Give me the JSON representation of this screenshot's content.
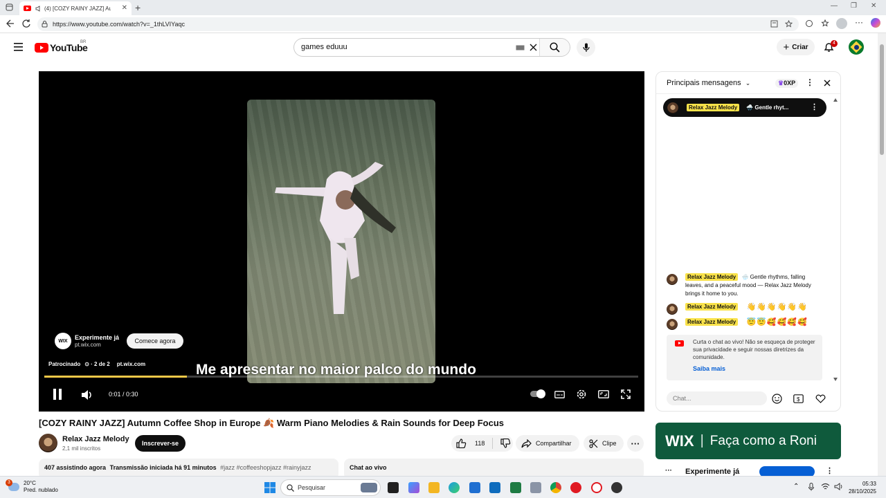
{
  "browser": {
    "tab_title": "(4) [COZY RAINY JAZZ] Autumn",
    "url": "https://www.youtube.com/watch?v=_1thLVIYaqc"
  },
  "header": {
    "logo_text": "YouTube",
    "country_code": "BR",
    "search_value": "games eduuu",
    "create_label": "Criar",
    "notif_count": "4"
  },
  "player": {
    "subtitle": "Me apresentar no maior palco do mundo",
    "ad_title": "Experimente já",
    "ad_domain": "pt.wix.com",
    "ad_cta": "Comece agora",
    "sponsored": "Patrocinado",
    "ad_count": "2 de 2",
    "ad_site": "pt.wix.com",
    "wix_badge": "WIX",
    "time": "0:01 / 0:30",
    "progress": 0.24
  },
  "video": {
    "title": "[COZY RAINY JAZZ] Autumn Coffee Shop in Europe 🍂 Warm Piano Melodies & Rain Sounds for Deep Focus",
    "channel": "Relax Jazz Melody",
    "subs": "2,1 mil inscritos",
    "subscribe": "Inscrever-se",
    "likes": "118",
    "share": "Compartilhar",
    "clip": "Clipe",
    "watching": "407 assistindo agora",
    "started": "Transmissão iniciada há 91 minutos",
    "tags": "#jazz #coffeeshopjazz #rainyjazz",
    "live_chat_label": "Chat ao vivo"
  },
  "chat": {
    "title": "Principais mensagens",
    "xp": "0XP",
    "pinned_author": "Relax Jazz Melody",
    "pinned_text": "🌧️ Gentle rhyt...",
    "messages": [
      {
        "author": "Relax Jazz Melody",
        "text": "🌧️ Gentle rhythms, falling leaves, and a peaceful mood — Relax Jazz Melody brings it home to you."
      },
      {
        "author": "Relax Jazz Melody",
        "text": "👋👋👋👋👋👋"
      },
      {
        "author": "Relax Jazz Melody",
        "text": "😇😇🥰🥰🥰🥰"
      }
    ],
    "notice": "Curta o chat ao vivo! Não se esqueça de proteger sua privacidade e seguir nossas diretrizes da comunidade.",
    "notice_link": "Saiba mais",
    "input_placeholder": "Chat..."
  },
  "banner": {
    "logo": "WIX",
    "slogan": "Faça como a Roni",
    "row_title": "Experimente já"
  },
  "taskbar": {
    "badge": "3",
    "temp": "20°C",
    "forecast": "Pred. nublado",
    "search": "Pesquisar",
    "time": "05:33",
    "date": "28/10/2025"
  }
}
